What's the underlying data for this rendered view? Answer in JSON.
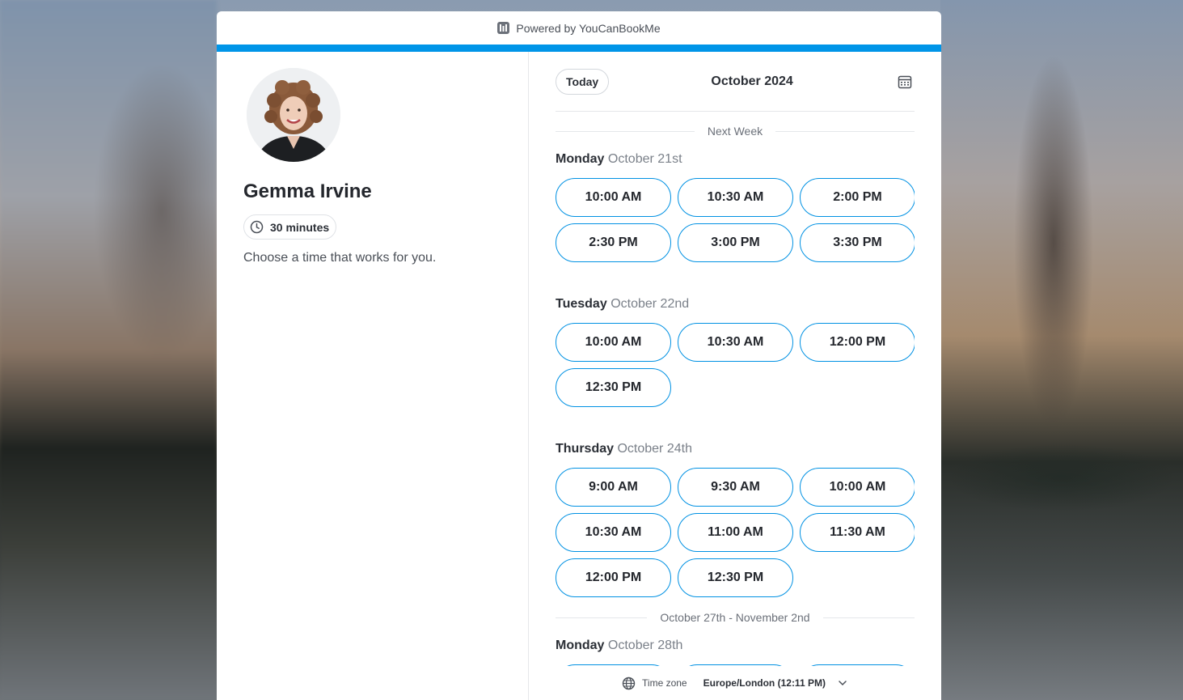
{
  "powered_by": "Powered by YouCanBookMe",
  "host": {
    "name": "Gemma Irvine",
    "duration": "30 minutes",
    "intro": "Choose a time that works for you."
  },
  "calendar": {
    "today_label": "Today",
    "month": "October 2024",
    "dividers": [
      "Next Week",
      "October 27th - November 2nd"
    ],
    "days": [
      {
        "weekday": "Monday",
        "date": "October 21st",
        "slots": [
          "10:00 AM",
          "10:30 AM",
          "2:00 PM",
          "2:30 PM",
          "3:00 PM",
          "3:30 PM"
        ]
      },
      {
        "weekday": "Tuesday",
        "date": "October 22nd",
        "slots": [
          "10:00 AM",
          "10:30 AM",
          "12:00 PM",
          "12:30 PM"
        ]
      },
      {
        "weekday": "Thursday",
        "date": "October 24th",
        "slots": [
          "9:00 AM",
          "9:30 AM",
          "10:00 AM",
          "10:30 AM",
          "11:00 AM",
          "11:30 AM",
          "12:00 PM",
          "12:30 PM"
        ]
      },
      {
        "weekday": "Monday",
        "date": "October 28th",
        "slots": [
          "",
          "",
          ""
        ]
      }
    ]
  },
  "timezone": {
    "label": "Time zone",
    "value": "Europe/London (12:11 PM)"
  },
  "colors": {
    "accent": "#0095e8",
    "slot_border": "#0091e3"
  },
  "icons": [
    "youcanbookme-logo-icon",
    "clock-icon",
    "calendar-icon",
    "globe-icon",
    "chevron-down-icon"
  ]
}
